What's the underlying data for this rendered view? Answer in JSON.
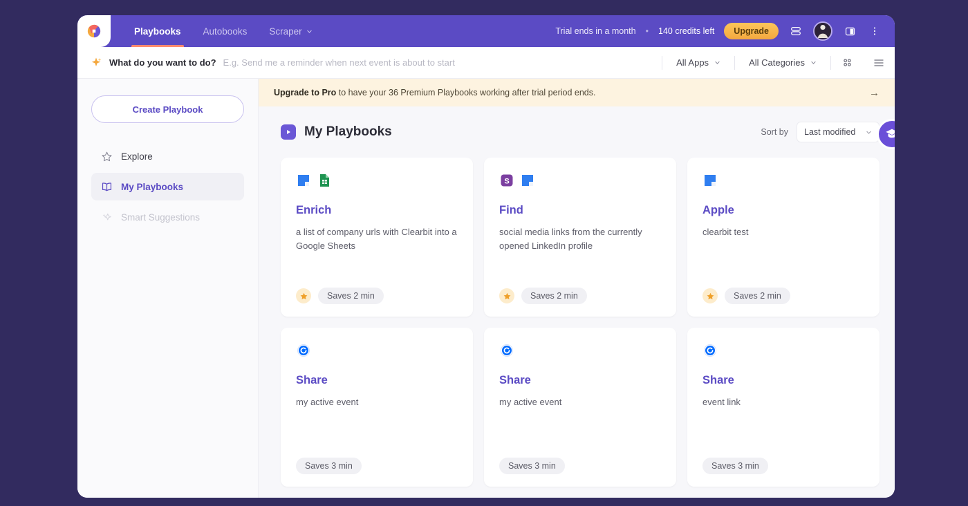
{
  "topnav": {
    "logo_icon": "circle-logo-icon",
    "tabs": [
      {
        "label": "Playbooks",
        "active": true,
        "has_caret": false
      },
      {
        "label": "Autobooks",
        "active": false,
        "has_caret": false
      },
      {
        "label": "Scraper",
        "active": false,
        "has_caret": true
      }
    ],
    "trial_text": "Trial ends in a month",
    "separator": "•",
    "credits_text": "140 credits left",
    "upgrade_label": "Upgrade",
    "icons": [
      "stacked-lines-icon",
      "user-avatar",
      "panel-toggle-icon",
      "more-vertical-icon"
    ]
  },
  "search": {
    "spark_icon": "sparkle-icon",
    "label": "What do you want to do?",
    "placeholder": "E.g. Send me a reminder when next event is about to start",
    "value": "",
    "filters": [
      {
        "label": "All Apps",
        "icon": "chevron-down-icon"
      },
      {
        "label": "All Categories",
        "icon": "chevron-down-icon"
      }
    ],
    "view_grid_icon": "grid-view-icon",
    "view_list_icon": "list-view-icon"
  },
  "sidebar": {
    "create_label": "Create Playbook",
    "items": [
      {
        "label": "Explore",
        "icon": "star-icon",
        "state": "default"
      },
      {
        "label": "My Playbooks",
        "icon": "book-icon",
        "state": "active"
      },
      {
        "label": "Smart Suggestions",
        "icon": "sparkle-icon",
        "state": "disabled"
      }
    ]
  },
  "promo": {
    "bold_text": "Upgrade to Pro",
    "rest_text": " to have your 36 Premium Playbooks working after trial period ends.",
    "arrow_icon": "arrow-right-icon"
  },
  "main": {
    "badge_icon": "play-icon",
    "title": "My Playbooks",
    "sort_label": "Sort by",
    "sort_value": "Last modified",
    "sort_caret_icon": "chevron-down-icon",
    "help_fab_icon": "graduation-cap-icon"
  },
  "cards": [
    {
      "apps": [
        "clearbit-icon",
        "google-sheets-icon"
      ],
      "title": "Enrich",
      "description": "a list of company urls with Clearbit into a Google Sheets",
      "starred": true,
      "star_icon": "star-filled-icon",
      "saves": "Saves 2 min"
    },
    {
      "apps": [
        "snov-icon",
        "clearbit-icon"
      ],
      "title": "Find",
      "description": "social media links from the currently opened LinkedIn profile",
      "starred": true,
      "star_icon": "star-filled-icon",
      "saves": "Saves 2 min"
    },
    {
      "apps": [
        "clearbit-icon"
      ],
      "title": "Apple",
      "description": "clearbit test",
      "starred": true,
      "star_icon": "star-filled-icon",
      "saves": "Saves 2 min"
    },
    {
      "apps": [
        "calendly-icon"
      ],
      "title": "Share",
      "description": "my active event",
      "starred": false,
      "star_icon": "",
      "saves": "Saves 3 min"
    },
    {
      "apps": [
        "calendly-icon"
      ],
      "title": "Share",
      "description": "my active event",
      "starred": false,
      "star_icon": "",
      "saves": "Saves 3 min"
    },
    {
      "apps": [
        "calendly-icon"
      ],
      "title": "Share",
      "description": "event link",
      "starred": false,
      "star_icon": "",
      "saves": "Saves 3 min"
    }
  ],
  "colors": {
    "desktop_bg": "#322b5f",
    "nav_bg": "#5b4bc4",
    "accent": "#5b4bc4",
    "active_underline": "#ff8a6f",
    "upgrade_bg": "#f4a83f",
    "promo_bg": "#fdf3e0",
    "main_bg": "#f7f7fa",
    "card_bg": "#ffffff"
  }
}
